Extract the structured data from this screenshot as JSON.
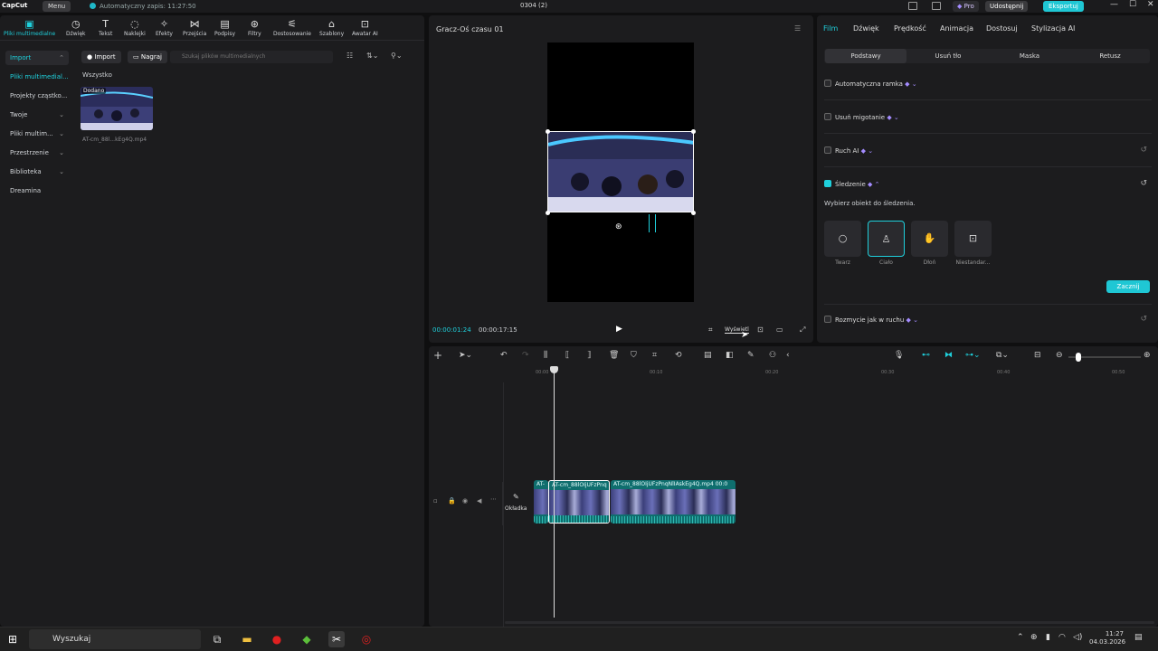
{
  "titlebar": {
    "logo": "CapCut",
    "menu": "Menu",
    "autosave": "Automatyczny zapis: 11:27:50",
    "project": "0304 (2)",
    "pro": "Pro",
    "share": "Udostępnij",
    "export": "Eksportuj",
    "accent": "#1fc7d4"
  },
  "toolbar": {
    "items": [
      {
        "label": "Pliki multimedialne",
        "icon": "media-icon"
      },
      {
        "label": "Dźwięk",
        "icon": "audio-icon"
      },
      {
        "label": "Tekst",
        "icon": "text-icon"
      },
      {
        "label": "Naklejki",
        "icon": "sticker-icon"
      },
      {
        "label": "Efekty",
        "icon": "effects-icon"
      },
      {
        "label": "Przejścia",
        "icon": "transitions-icon"
      },
      {
        "label": "Podpisy",
        "icon": "captions-icon"
      },
      {
        "label": "Filtry",
        "icon": "filters-icon"
      },
      {
        "label": "Dostosowanie",
        "icon": "adjust-icon"
      },
      {
        "label": "Szablony",
        "icon": "templates-icon"
      },
      {
        "label": "Awatar AI",
        "icon": "avatar-icon"
      }
    ]
  },
  "sidebar": {
    "items": [
      {
        "label": "Import"
      },
      {
        "label": "Pliki multimedial..."
      },
      {
        "label": "Projekty cząstko..."
      },
      {
        "label": "Twoje"
      },
      {
        "label": "Pliki multim..."
      },
      {
        "label": "Przestrzenie"
      },
      {
        "label": "Biblioteka"
      },
      {
        "label": "Dreamina"
      }
    ]
  },
  "media": {
    "import_btn": "Import",
    "record_btn": "Nagraj",
    "search_placeholder": "Szukaj plików multimedialnych",
    "all_label": "Wszystko",
    "item_badge": "Dodano",
    "item_name": "AT-cm_88l...kEg4Q.mp4"
  },
  "preview": {
    "title": "Gracz-Oś czasu 01",
    "timecode": "00:00:01:24",
    "duration": "00:00:17:15",
    "view_label": "Wyświetl"
  },
  "rightpanel": {
    "tabs": [
      "Film",
      "Dźwięk",
      "Prędkość",
      "Animacja",
      "Dostosuj",
      "Stylizacja AI"
    ],
    "subtabs": [
      "Podstawy",
      "Usuń tło",
      "Maska",
      "Retusz"
    ],
    "options": {
      "auto_frame": "Automatyczna ramka",
      "remove_flicker": "Usuń migotanie",
      "ai_motion": "Ruch AI",
      "tracking": "Śledzenie",
      "motion_blur": "Rozmycie jak w ruchu"
    },
    "tracking_hint": "Wybierz obiekt do śledzenia.",
    "track_targets": [
      {
        "label": "Twarz",
        "icon": "face-icon"
      },
      {
        "label": "Ciało",
        "icon": "body-icon"
      },
      {
        "label": "Dłoń",
        "icon": "hand-icon"
      },
      {
        "label": "Niestandar...",
        "icon": "custom-icon"
      }
    ],
    "start_btn": "Zacznij"
  },
  "timeline": {
    "ruler": [
      "00:00",
      "00:10",
      "00:20",
      "00:30",
      "00:40",
      "00:50"
    ],
    "cover_label": "Okładka",
    "clips": [
      {
        "label": "AT-"
      },
      {
        "label": "AT-cm_88lOIjUFzPnq"
      },
      {
        "label": "AT-cm_88lOIjUFzPnqNlIAskEg4Q.mp4   00:0"
      }
    ]
  },
  "taskbar": {
    "search": "Wyszukaj",
    "time": "11:27",
    "date": "04.03.2026"
  }
}
